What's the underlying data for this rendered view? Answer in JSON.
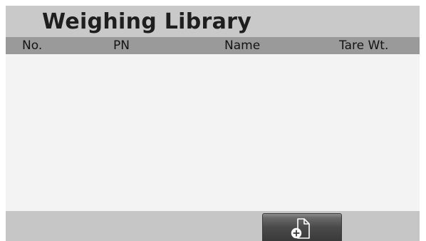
{
  "header": {
    "title": "Weighing Library"
  },
  "table": {
    "columns": [
      "No.",
      "PN",
      "Name",
      "Tare Wt."
    ],
    "rows": []
  },
  "toolbar": {
    "add_button_icon": "add-document-icon"
  },
  "colors": {
    "title_bar": "#c9c9c9",
    "column_header": "#9a9a9a",
    "list_background": "#f3f3f3",
    "bottom_bar": "#c6c6c6",
    "button": "#4a4a4a"
  }
}
